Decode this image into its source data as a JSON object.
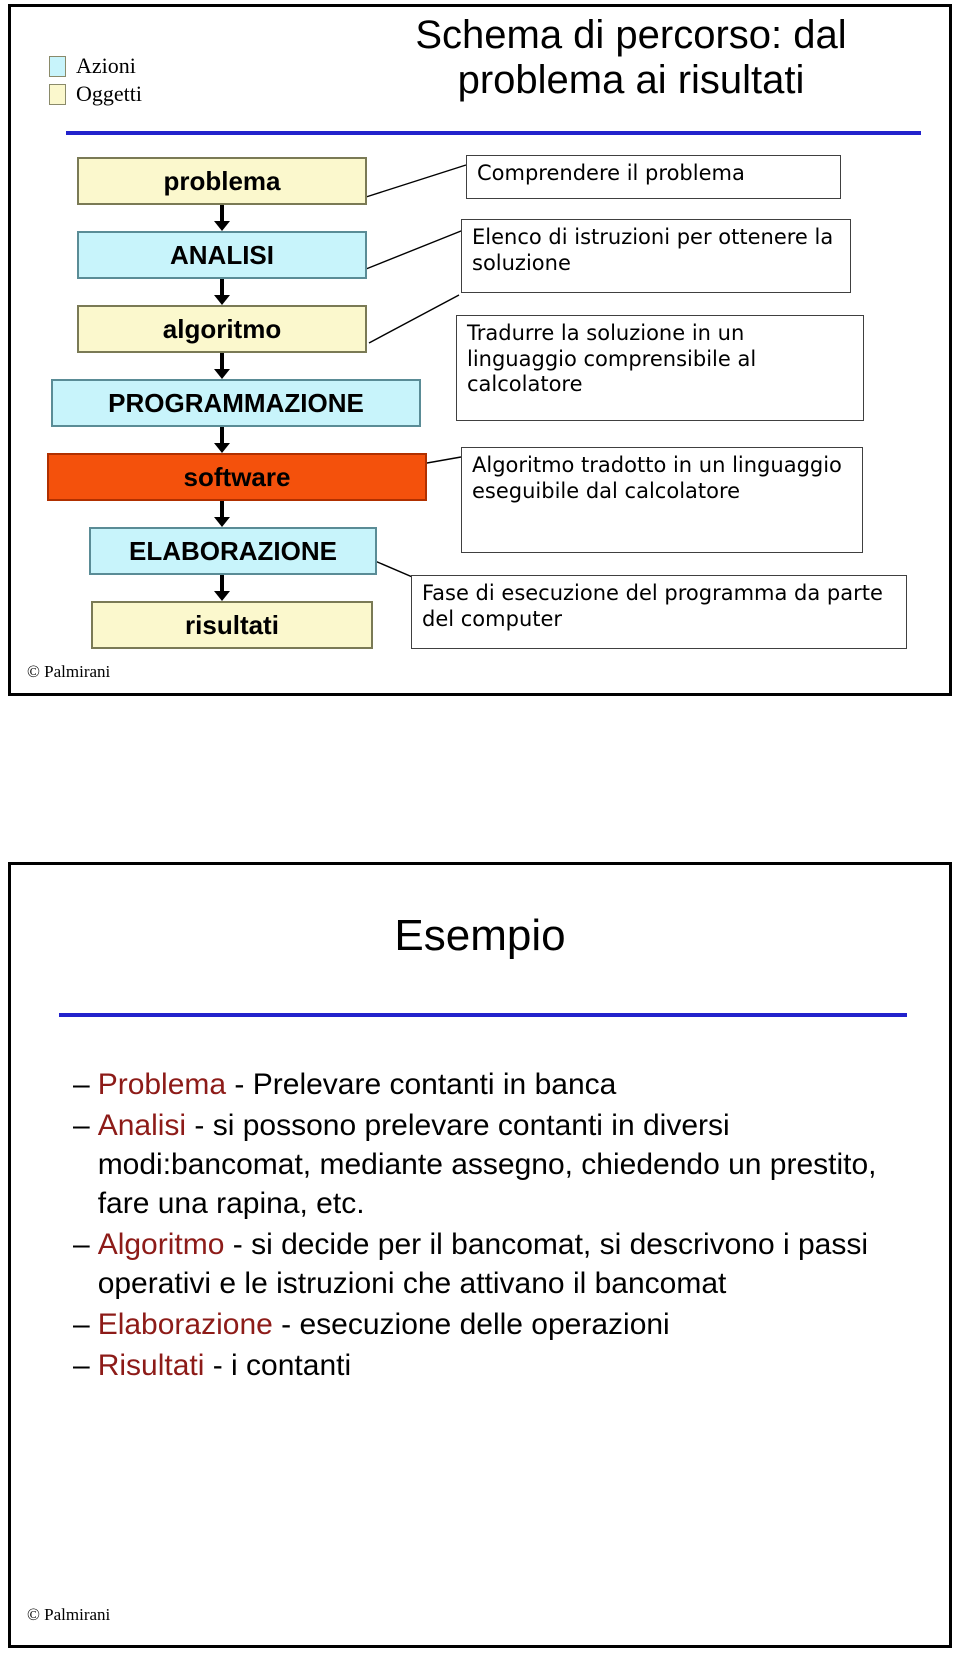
{
  "slide1": {
    "title": "Schema di percorso: dal problema ai risultati",
    "title_line1": "Schema di percorso: dal",
    "title_line2": "problema ai risultati",
    "legend": [
      {
        "label": "Azioni",
        "color": "#c8f4fb"
      },
      {
        "label": "Oggetti",
        "color": "#fbf8cd"
      }
    ],
    "flow": [
      {
        "label": "problema",
        "type": "oggetto",
        "color": "#fbf8cd"
      },
      {
        "label": "ANALISI",
        "type": "azione",
        "color": "#c8f4fb"
      },
      {
        "label": "algoritmo",
        "type": "oggetto",
        "color": "#fbf8cd"
      },
      {
        "label": "PROGRAMMAZIONE",
        "type": "azione",
        "color": "#c8f4fb"
      },
      {
        "label": "software",
        "type": "oggetto",
        "color": "#f4510c"
      },
      {
        "label": "ELABORAZIONE",
        "type": "azione",
        "color": "#c8f4fb"
      },
      {
        "label": "risultati",
        "type": "oggetto",
        "color": "#fbf8cd"
      }
    ],
    "descriptions": [
      "Comprendere il problema",
      "Elenco di istruzioni per ottenere la soluzione",
      "Tradurre la soluzione in un linguaggio comprensibile al calcolatore",
      "Algoritmo tradotto in un linguaggio eseguibile dal calcolatore",
      "Fase di esecuzione del programma da parte del computer"
    ],
    "rule_color": "#2222cc",
    "copyright": "© Palmirani"
  },
  "slide2": {
    "title": "Esempio",
    "rule_color": "#2222cc",
    "keyword_color": "#8d1b18",
    "bullets": [
      {
        "dash": "–",
        "keyword": "Problema",
        "rest": " - Prelevare contanti in banca"
      },
      {
        "dash": "–",
        "keyword": "Analisi",
        "rest": " - si possono prelevare contanti in diversi modi:bancomat, mediante assegno, chiedendo un prestito, fare una rapina, etc."
      },
      {
        "dash": "–",
        "keyword": "Algoritmo",
        "rest": " - si decide per il bancomat, si descrivono i passi operativi e le istruzioni che attivano il bancomat"
      },
      {
        "dash": "–",
        "keyword": "Elaborazione",
        "rest": " - esecuzione delle operazioni"
      },
      {
        "dash": "–",
        "keyword": "Risultati",
        "rest": " - i contanti"
      }
    ],
    "copyright": "© Palmirani"
  }
}
